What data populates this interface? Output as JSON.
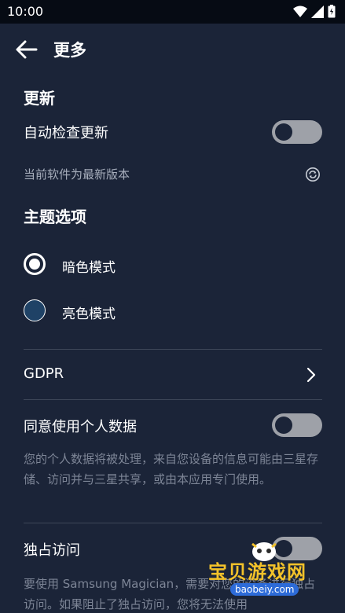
{
  "status_bar": {
    "time": "10:00"
  },
  "app_bar": {
    "title": "更多"
  },
  "update": {
    "section_title": "更新",
    "auto_check_label": "自动检查更新",
    "auto_check_on": false,
    "version_status": "当前软件为最新版本"
  },
  "theme": {
    "section_title": "主题选项",
    "options": [
      {
        "label": "暗色模式",
        "selected": true
      },
      {
        "label": "亮色模式",
        "selected": false
      }
    ]
  },
  "gdpr": {
    "label": "GDPR"
  },
  "personal_data": {
    "label": "同意使用个人数据",
    "enabled": false,
    "description": "您的个人数据将被处理，来自您设备的信息可能由三星存储、访问并与三星共享，或由本应用专门使用。"
  },
  "exclusive_access": {
    "label": "独占访问",
    "enabled": false,
    "description": "要使用 Samsung Magician，需要对您的设备进行独占访问。如果阻止了独占访问，您将无法使用"
  },
  "watermark": {
    "text": "宝贝游戏网",
    "url": "baobeiy.com"
  },
  "colors": {
    "background": "#1b2438",
    "status_bar": "#060b14",
    "toggle_off": "#9ea1a8",
    "radio_unselected_fill": "#1f4266"
  }
}
